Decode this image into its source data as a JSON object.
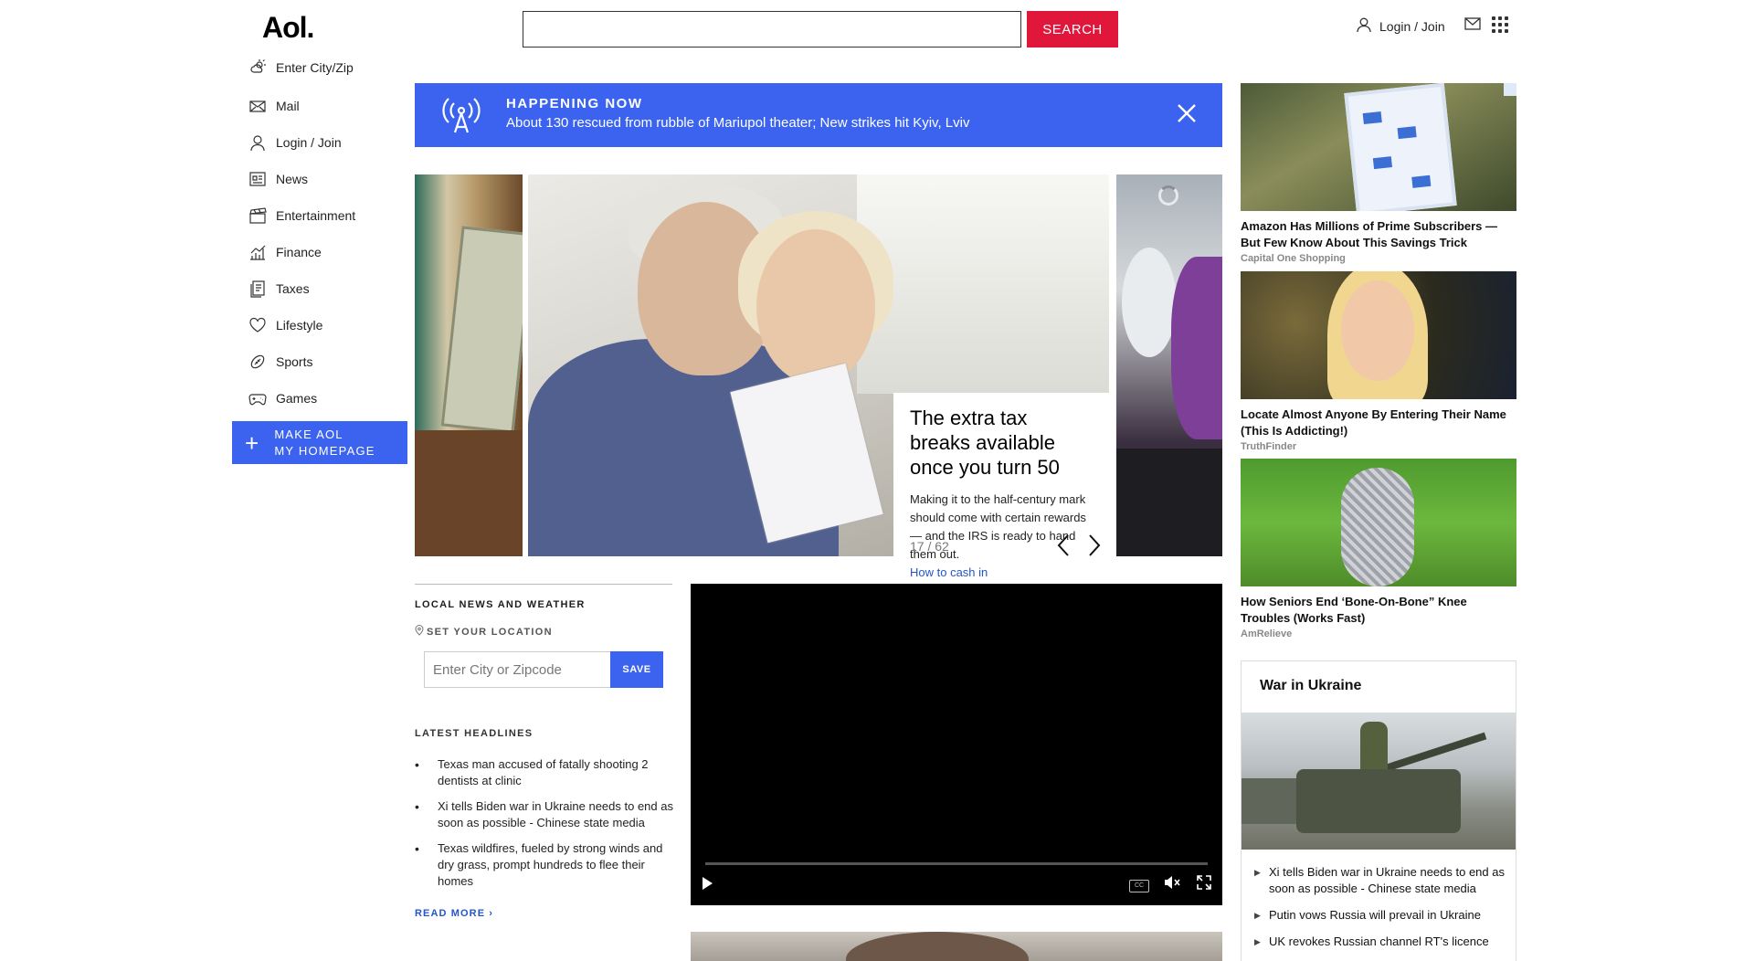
{
  "header": {
    "logo": "Aol.",
    "search_placeholder": "",
    "search_button": "SEARCH",
    "login": "Login / Join"
  },
  "nav": {
    "items": [
      {
        "label": "Enter City/Zip",
        "icon": "weather-icon"
      },
      {
        "label": "Mail",
        "icon": "mail-icon"
      },
      {
        "label": "Login / Join",
        "icon": "user-icon"
      },
      {
        "label": "News",
        "icon": "news-icon"
      },
      {
        "label": "Entertainment",
        "icon": "clapper-icon"
      },
      {
        "label": "Finance",
        "icon": "chart-icon"
      },
      {
        "label": "Taxes",
        "icon": "taxes-icon"
      },
      {
        "label": "Lifestyle",
        "icon": "heart-icon"
      },
      {
        "label": "Sports",
        "icon": "football-icon"
      },
      {
        "label": "Games",
        "icon": "gamepad-icon"
      }
    ],
    "make_home_line1": "MAKE AOL",
    "make_home_line2": "MY HOMEPAGE"
  },
  "happening": {
    "label": "HAPPENING NOW",
    "text": "About 130 rescued from rubble of Mariupol theater; New strikes hit Kyiv, Lviv"
  },
  "carousel": {
    "title": "The extra tax breaks available once you turn 50",
    "desc": "Making it to the half-century mark should come with certain rewards — and the IRS is ready to hand them out.",
    "link": "How to cash in",
    "counter": "17 / 62"
  },
  "local": {
    "title": "LOCAL NEWS AND WEATHER",
    "set_location": "SET YOUR LOCATION",
    "input_placeholder": "Enter City or Zipcode",
    "save": "SAVE",
    "latest_title": "LATEST HEADLINES",
    "headlines": [
      "Texas man accused of fatally shooting 2 dentists at clinic",
      "Xi tells Biden war in Ukraine needs to end as soon as possible - Chinese state media",
      "Texas wildfires, fueled by strong winds and dry grass, prompt hundreds to flee their homes"
    ],
    "read_more": "READ MORE ›"
  },
  "video": {
    "cc": "CC"
  },
  "ads": [
    {
      "title": "Amazon Has Millions of Prime Subscribers — But Few Know About This Savings Trick",
      "source": "Capital One Shopping"
    },
    {
      "title": "Locate Almost Anyone By Entering Their Name (This Is Addicting!)",
      "source": "TruthFinder"
    },
    {
      "title": "How Seniors End ‘Bone-On-Bone” Knee Troubles (Works Fast)",
      "source": "AmRelieve"
    }
  ],
  "war": {
    "title": "War in Ukraine",
    "items": [
      "Xi tells Biden war in Ukraine needs to end as soon as possible - Chinese state media",
      "Putin vows Russia will prevail in Ukraine",
      "UK revokes Russian channel RT's licence"
    ]
  },
  "colors": {
    "brand_blue": "#3b63f0",
    "search_red": "#e0173b",
    "link_blue": "#2456c8"
  }
}
